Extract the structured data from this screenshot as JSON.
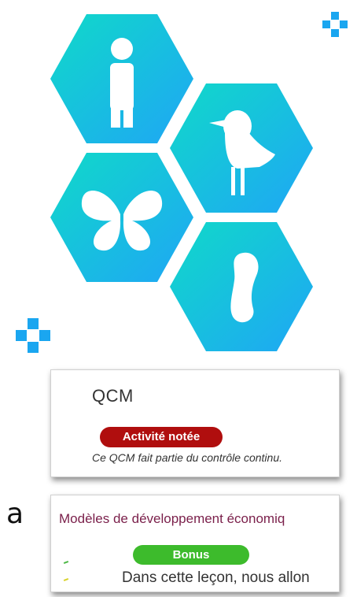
{
  "hero": {
    "icons": [
      "person-icon",
      "bird-icon",
      "butterfly-icon",
      "footprint-icon"
    ],
    "gradient": [
      "#10d9c9",
      "#1fa6f5"
    ]
  },
  "card_qcm": {
    "title": "QCM",
    "badge": "Activité notée",
    "badge_color": "#b00e0e",
    "description": "Ce QCM fait partie du contrôle continu."
  },
  "card_bonus": {
    "title": "Modèles de développement économiq",
    "badge": "Bonus",
    "badge_color": "#3dbb2c",
    "description": "Dans cette leçon, nous allon"
  },
  "side_label": "a"
}
